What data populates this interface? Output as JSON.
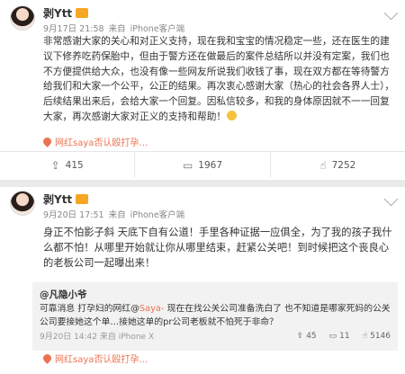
{
  "post1": {
    "username": "剥Ytt",
    "meta": {
      "date": "9月17日 21:58",
      "from": "来自",
      "source": "iPhone客户端"
    },
    "body": "非常感谢大家的关心和对正义支持，现在我和宝宝的情况稳定一些，还在医生的建议下修养吃药保胎中，但由于警方还在做最后的案件总结所以并没有定案，我们也不方便提供给大众，也没有像一些网友所说我们收钱了事，现在双方都在等待警方给我们和大家一个公平，公正的结果。再次衷心感谢大家（热心的社会各界人士），后续结果出来后，会给大家一个回复。因私信较多，和我的身体原因就不一一回复大家，再次感谢大家对正义的支持和帮助！",
    "link": "网红saya否认殴打孕…",
    "actions": {
      "repost": "415",
      "comment": "1967",
      "like": "7252"
    }
  },
  "post2": {
    "username": "剥Ytt",
    "meta": {
      "date": "9月20日 17:51",
      "from": "来自",
      "source": "iPhone客户端"
    },
    "body": "身正不怕影子斜 天底下自有公道！手里各种证据一应俱全，为了我的孩子我什么都不怕！从哪里开始就让你从哪里结束，赶紧公关吧！到时候把这个丧良心的老板公司一起曝出来！",
    "repost": {
      "author": "@凡隐小爷",
      "body_prefix": "可靠消息 打孕妇的网红@",
      "mention": "Saya-",
      "body_rest": " 现在在找公关公司准备洗白了 也不知道是哪家死妈的公关公司要接她这个单…接她这单的pr公司老板就不怕死于非命？",
      "meta": "9月20日 14:42 来自 iPhone X",
      "repost_count": "45",
      "comment_count": "11",
      "like_count": "5146"
    },
    "link": "网红saya否认殴打孕…"
  }
}
